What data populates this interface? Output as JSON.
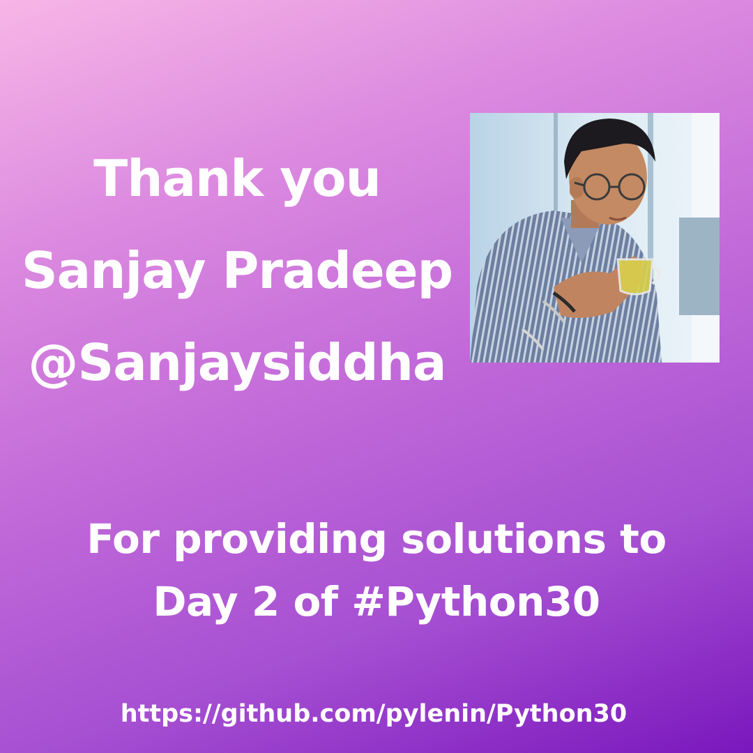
{
  "heading": {
    "line1": "Thank you",
    "line2": "Sanjay Pradeep",
    "line3": "@Sanjaysiddha"
  },
  "subtitle": {
    "line1": "For providing solutions to",
    "line2": "Day 2 of #Python30"
  },
  "link": "https://github.com/pylenin/Python30",
  "colors": {
    "gradient_top": "#f7b6e6",
    "gradient_bottom": "#7a17bd",
    "text": "#ffffff"
  }
}
